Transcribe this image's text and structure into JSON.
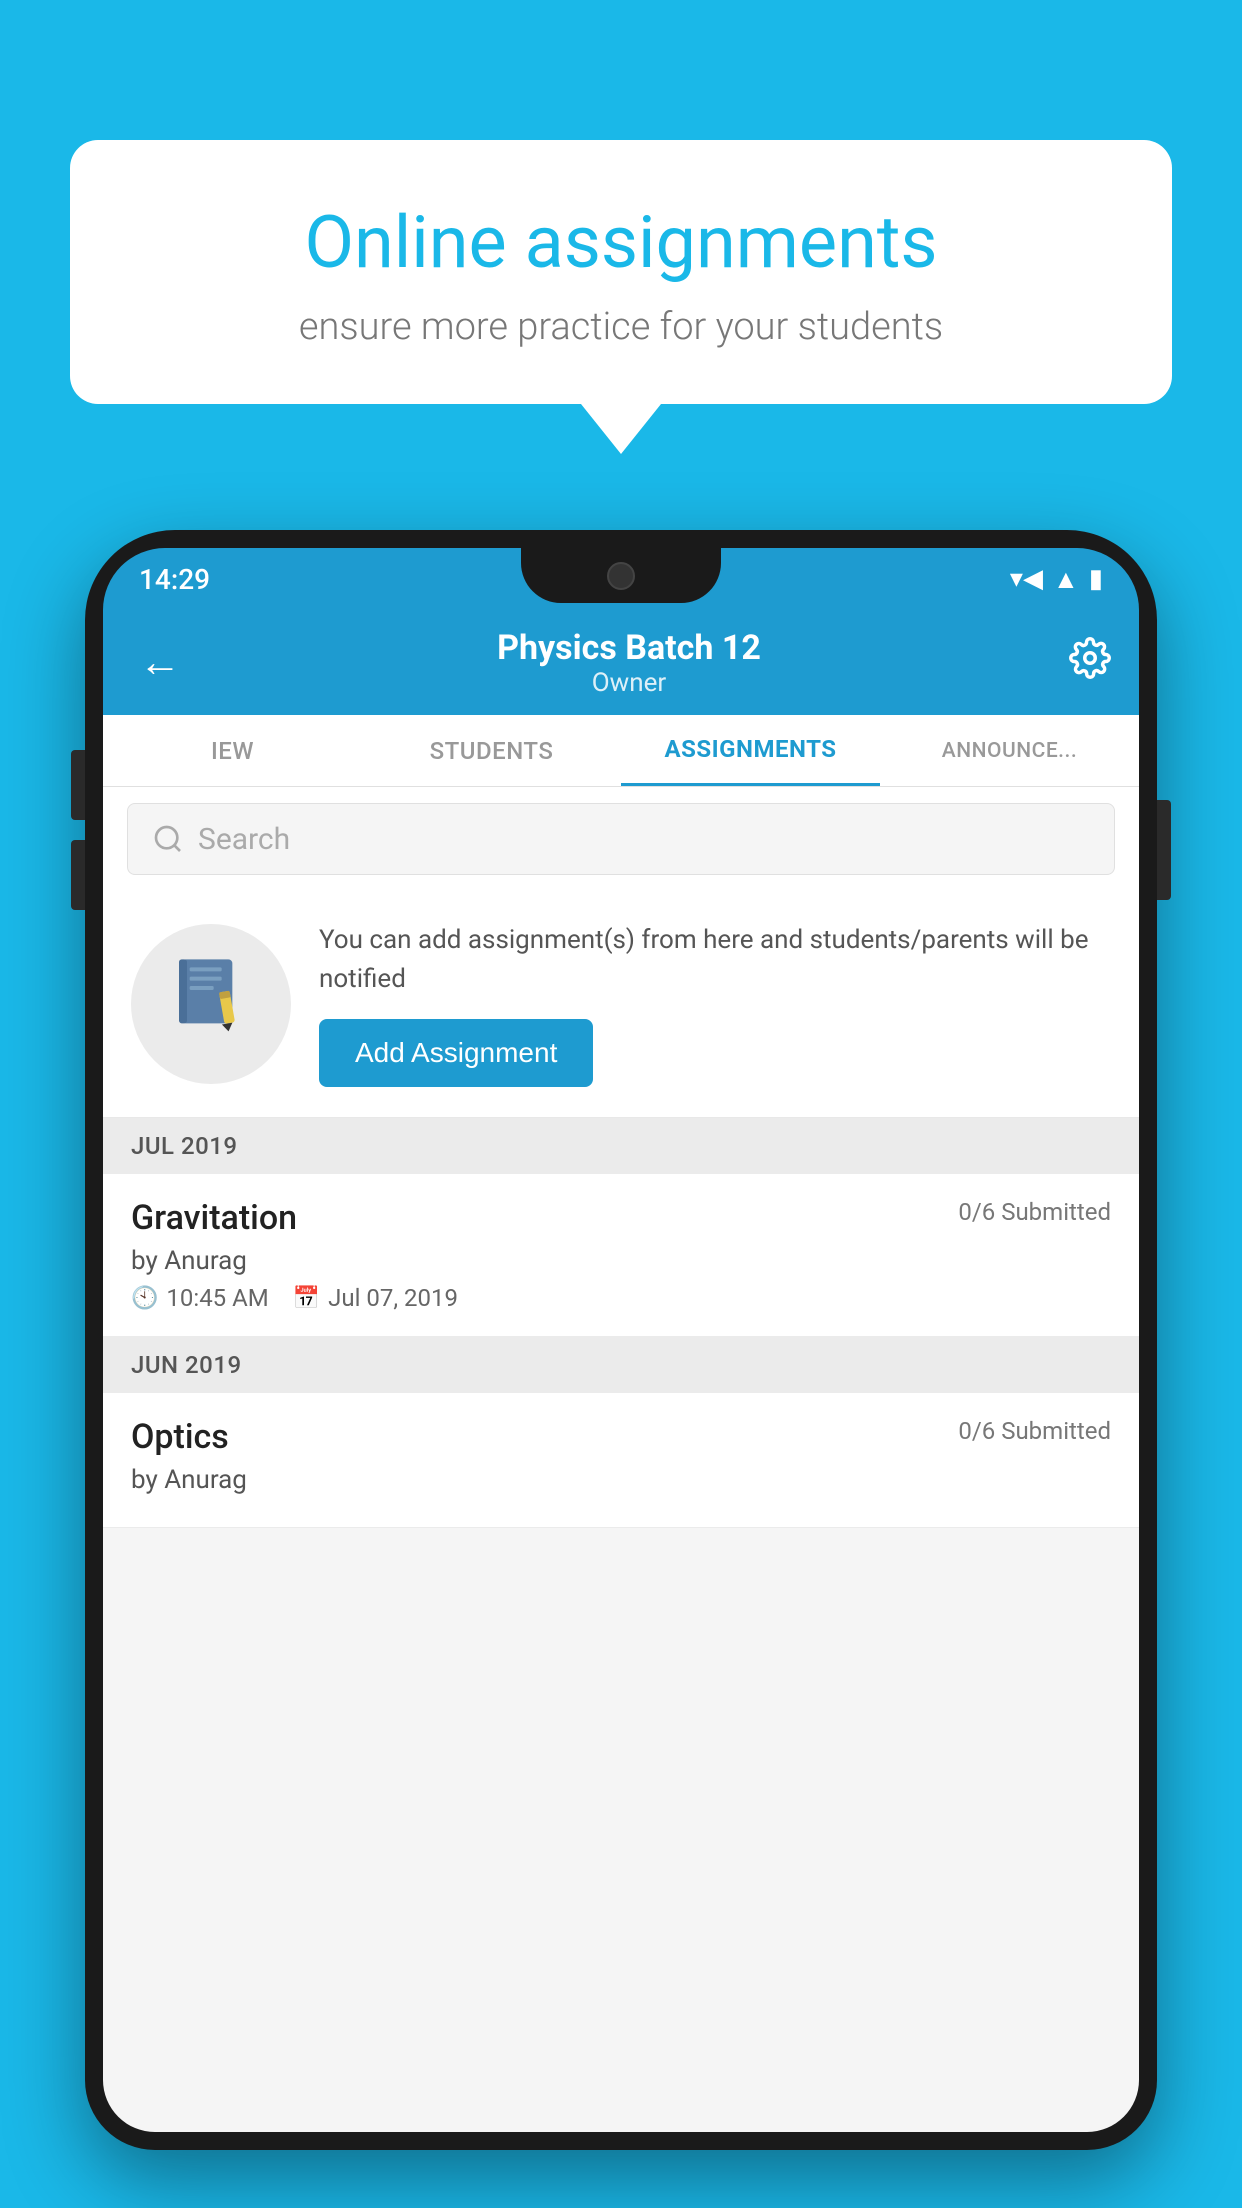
{
  "background_color": "#1ab8e8",
  "speech_bubble": {
    "title": "Online assignments",
    "subtitle": "ensure more practice for your students"
  },
  "status_bar": {
    "time": "14:29",
    "icons": [
      "wifi",
      "signal",
      "battery"
    ]
  },
  "top_bar": {
    "title": "Physics Batch 12",
    "subtitle": "Owner",
    "back_label": "←",
    "settings_label": "⚙"
  },
  "tabs": [
    {
      "label": "IEW",
      "active": false
    },
    {
      "label": "STUDENTS",
      "active": false
    },
    {
      "label": "ASSIGNMENTS",
      "active": true
    },
    {
      "label": "ANNOUNCEME...",
      "active": false
    }
  ],
  "search": {
    "placeholder": "Search"
  },
  "add_assignment_section": {
    "info_text": "You can add assignment(s) from here and students/parents will be notified",
    "button_label": "Add Assignment"
  },
  "sections": [
    {
      "header": "JUL 2019",
      "items": [
        {
          "name": "Gravitation",
          "submitted": "0/6 Submitted",
          "by": "by Anurag",
          "time": "10:45 AM",
          "date": "Jul 07, 2019"
        }
      ]
    },
    {
      "header": "JUN 2019",
      "items": [
        {
          "name": "Optics",
          "submitted": "0/6 Submitted",
          "by": "by Anurag",
          "time": "",
          "date": ""
        }
      ]
    }
  ]
}
